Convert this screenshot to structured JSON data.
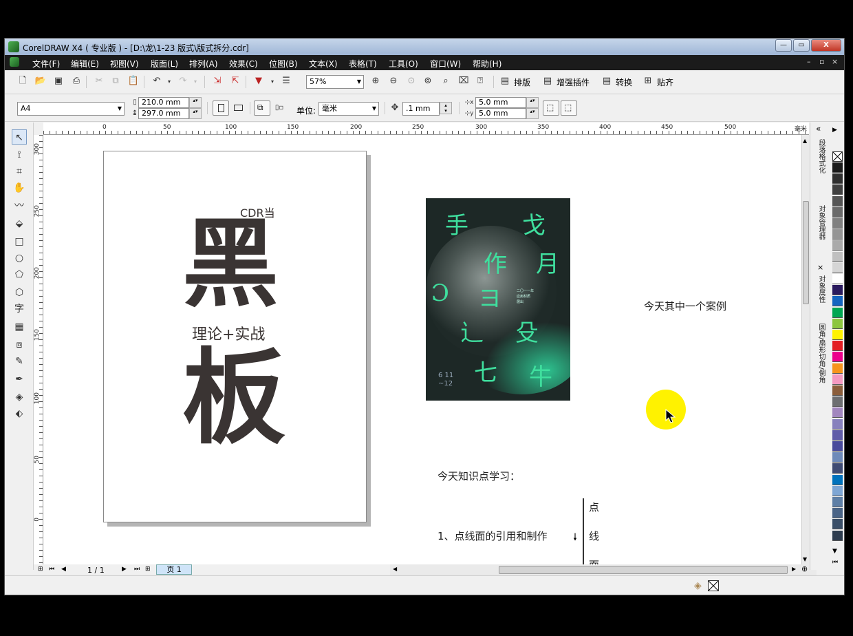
{
  "title": "CorelDRAW X4 ( 专业版 ) - [D:\\龙\\1-23 版式\\版式拆分.cdr]",
  "window_controls": {
    "min": "—",
    "max": "▭",
    "close": "X"
  },
  "menu": [
    "文件(F)",
    "编辑(E)",
    "视图(V)",
    "版面(L)",
    "排列(A)",
    "效果(C)",
    "位图(B)",
    "文本(X)",
    "表格(T)",
    "工具(O)",
    "窗口(W)",
    "帮助(H)"
  ],
  "menu_right": {
    "min": "–",
    "restore": "▫",
    "close": "×"
  },
  "standard_toolbar": {
    "zoom": "57%",
    "plugins": [
      "排版",
      "增强插件",
      "转换",
      "贴齐"
    ]
  },
  "property_bar": {
    "paper": "A4",
    "width": "210.0 mm",
    "height": "297.0 mm",
    "units_label": "单位:",
    "units": "毫米",
    "nudge": ".1 mm",
    "dup_x": "5.0 mm",
    "dup_y": "5.0 mm"
  },
  "ruler": {
    "top_labels": [
      "0",
      "50",
      "100",
      "150",
      "200",
      "250",
      "300",
      "350",
      "400",
      "450",
      "500"
    ],
    "top_unit": "毫米",
    "left_labels": [
      "300",
      "250",
      "200",
      "150",
      "100",
      "50",
      "0"
    ]
  },
  "page_content": {
    "line1": "CDR当",
    "big1": "黑",
    "middle": "理论+实战",
    "big2": "板"
  },
  "poster_glyphs": [
    "手",
    "戈",
    "作",
    "月",
    "Ɔ",
    "ヨ",
    "辶",
    "殳",
    "七",
    "牛"
  ],
  "poster_small": [
    "二〇一一年",
    "应用材质",
    "展出"
  ],
  "poster_date": "6 11\n~12",
  "canvas_text": {
    "case": "今天其中一个案例",
    "knowledge": "今天知识点学习：",
    "item1": "1、点线面的引用和制作",
    "branch": [
      "点",
      "线",
      "面"
    ]
  },
  "pager": {
    "count": "1 / 1",
    "tab": "页 1"
  },
  "dockers": [
    "段落格式化",
    "对象管理器",
    "对象属性",
    "圆角/扇形切角/倒角"
  ],
  "palette": [
    "#1a1a1a",
    "#2f2f2f",
    "#404040",
    "#555555",
    "#6a6a6a",
    "#808080",
    "#959595",
    "#aaaaaa",
    "#c0c0c0",
    "#d5d5d5",
    "#ffffff",
    "#2a1a5e",
    "#1565c0",
    "#00a651",
    "#8dc63f",
    "#fff200",
    "#e31e24",
    "#ec008c",
    "#f7941d",
    "#f49ac1",
    "#8b5e3c",
    "#6d6e71",
    "#a186be",
    "#8781bd",
    "#605ca8",
    "#494a9b",
    "#6e8ab9",
    "#3f4b73",
    "#0072bc",
    "#7ea6d4",
    "#5e7fa6",
    "#4a6486",
    "#3b4f68",
    "#2d3c4f"
  ],
  "colors": {
    "titlebar": "#b1c5e0",
    "menubar": "#1b1b1b",
    "poster_green": "#3fdf9e",
    "big_text": "#3a3433",
    "cursor_highlight": "#fff200"
  }
}
